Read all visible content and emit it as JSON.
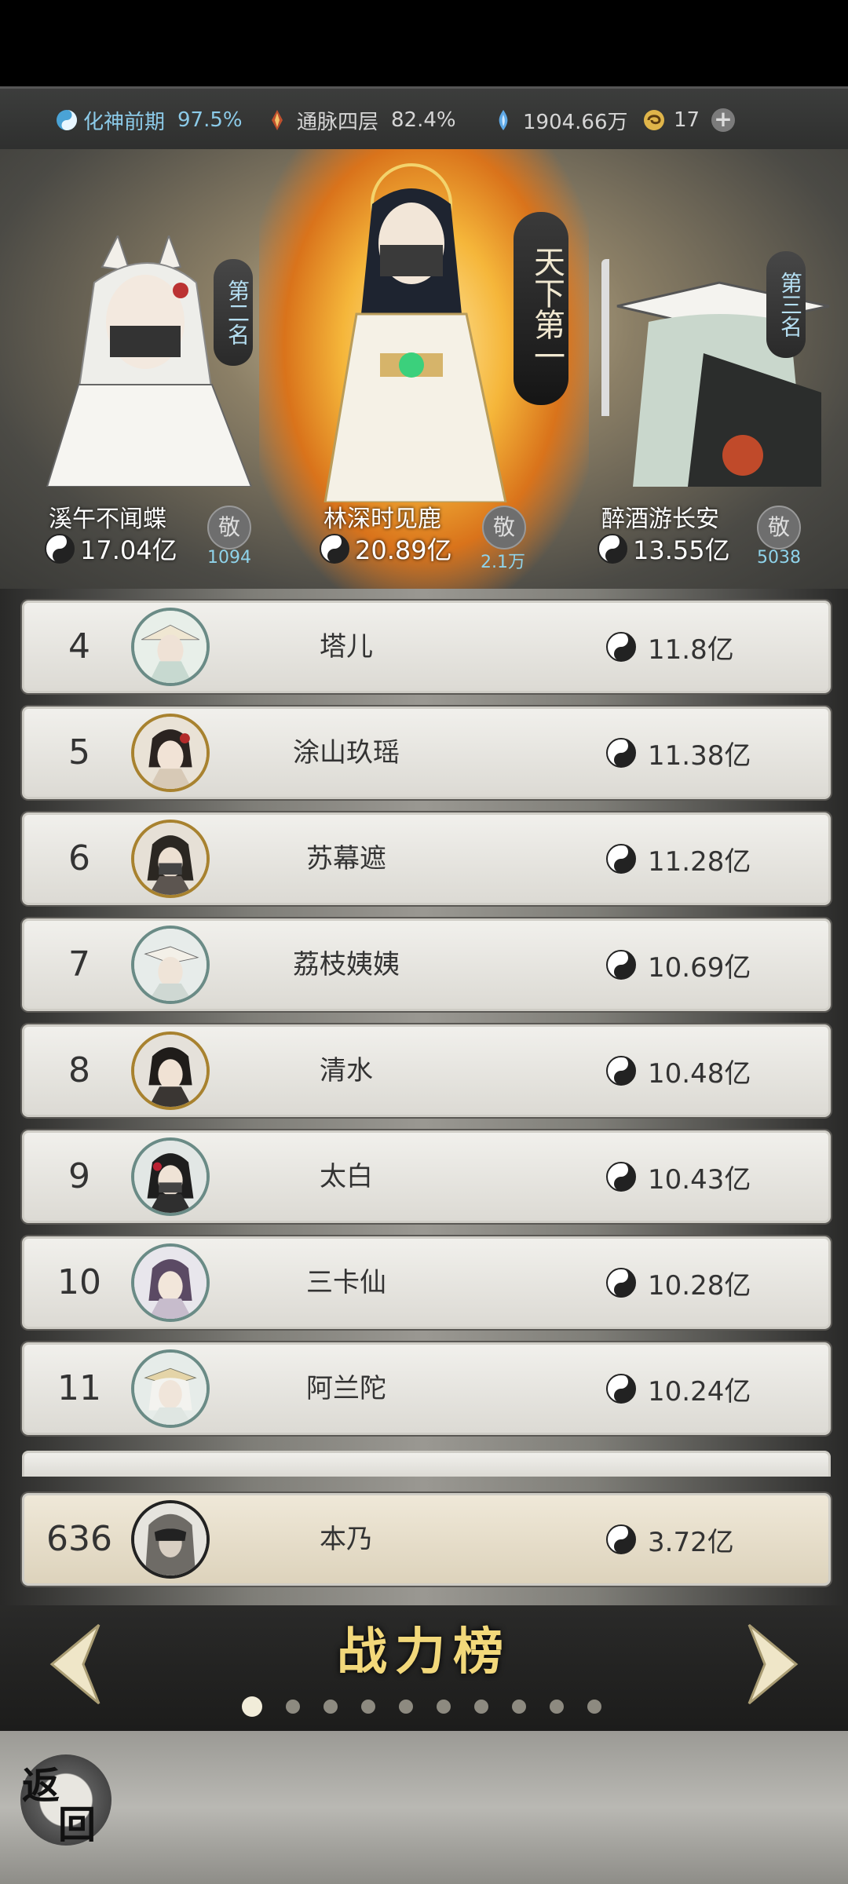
{
  "resources": {
    "realm": {
      "name": "化神前期",
      "value": "97.5%"
    },
    "meridian": {
      "name": "通脉四层",
      "value": "82.4%"
    },
    "spirit_stones": "1904.66万",
    "tokens": "17"
  },
  "top3": [
    {
      "rank_label": "第二名",
      "name": "溪午不闻蝶",
      "power": "17.04亿",
      "likes": "1094",
      "like_icon": "敬"
    },
    {
      "rank_label": "天下第一",
      "name": "林深时见鹿",
      "power": "20.89亿",
      "likes": "2.1万",
      "like_icon": "敬"
    },
    {
      "rank_label": "第三名",
      "name": "醉酒游长安",
      "power": "13.55亿",
      "likes": "5038",
      "like_icon": "敬"
    }
  ],
  "rankings": [
    {
      "rank": "4",
      "name": "塔儿",
      "power": "11.8亿"
    },
    {
      "rank": "5",
      "name": "涂山玖瑶",
      "power": "11.38亿"
    },
    {
      "rank": "6",
      "name": "苏幕遮",
      "power": "11.28亿"
    },
    {
      "rank": "7",
      "name": "荔枝姨姨",
      "power": "10.69亿"
    },
    {
      "rank": "8",
      "name": "清水",
      "power": "10.48亿"
    },
    {
      "rank": "9",
      "name": "太白",
      "power": "10.43亿"
    },
    {
      "rank": "10",
      "name": "三卡仙",
      "power": "10.28亿"
    },
    {
      "rank": "11",
      "name": "阿兰陀",
      "power": "10.24亿"
    }
  ],
  "my_rank": {
    "rank": "636",
    "name": "本乃",
    "power": "3.72亿"
  },
  "board": {
    "title": "战力榜",
    "page_count": 10,
    "active_page": 1
  },
  "back": {
    "top": "返",
    "bottom": "回"
  }
}
